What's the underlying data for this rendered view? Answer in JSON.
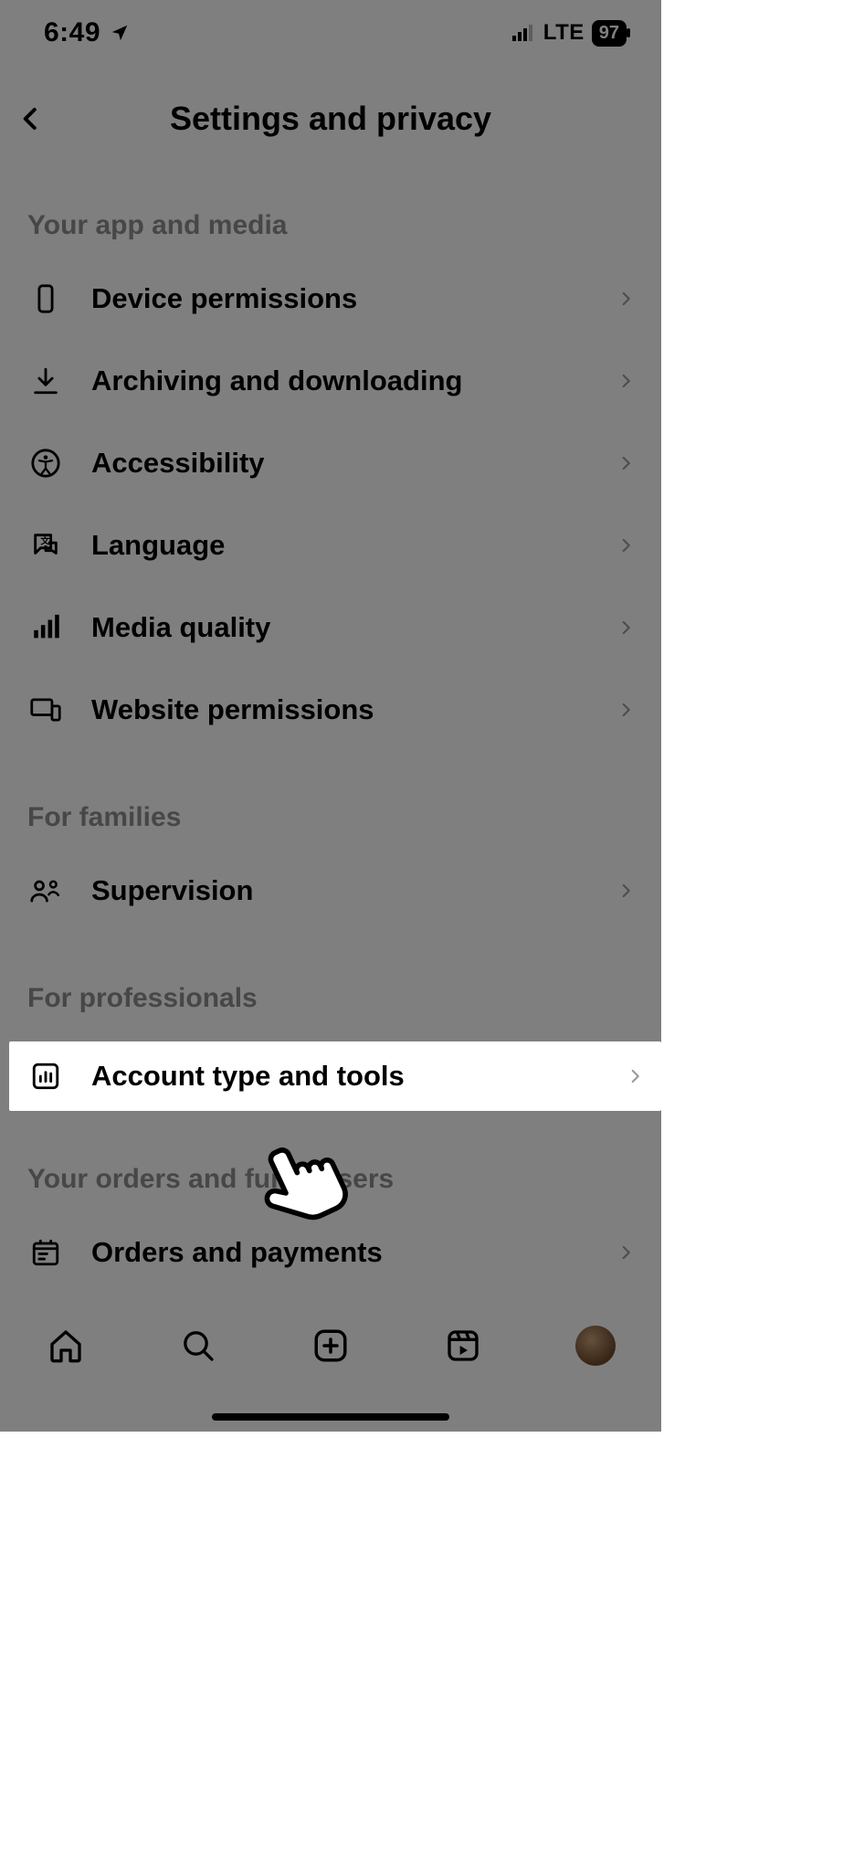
{
  "status": {
    "time": "6:49",
    "network": "LTE",
    "battery": "97"
  },
  "header": {
    "title": "Settings and privacy"
  },
  "sections": {
    "app_media": {
      "title": "Your app and media",
      "items": [
        {
          "label": "Device permissions"
        },
        {
          "label": "Archiving and downloading"
        },
        {
          "label": "Accessibility"
        },
        {
          "label": "Language"
        },
        {
          "label": "Media quality"
        },
        {
          "label": "Website permissions"
        }
      ]
    },
    "families": {
      "title": "For families",
      "items": [
        {
          "label": "Supervision"
        }
      ]
    },
    "professionals": {
      "title": "For professionals",
      "items": [
        {
          "label": "Account type and tools"
        }
      ]
    },
    "orders": {
      "title": "Your orders and fundraisers",
      "items": [
        {
          "label": "Orders and payments"
        }
      ]
    }
  }
}
